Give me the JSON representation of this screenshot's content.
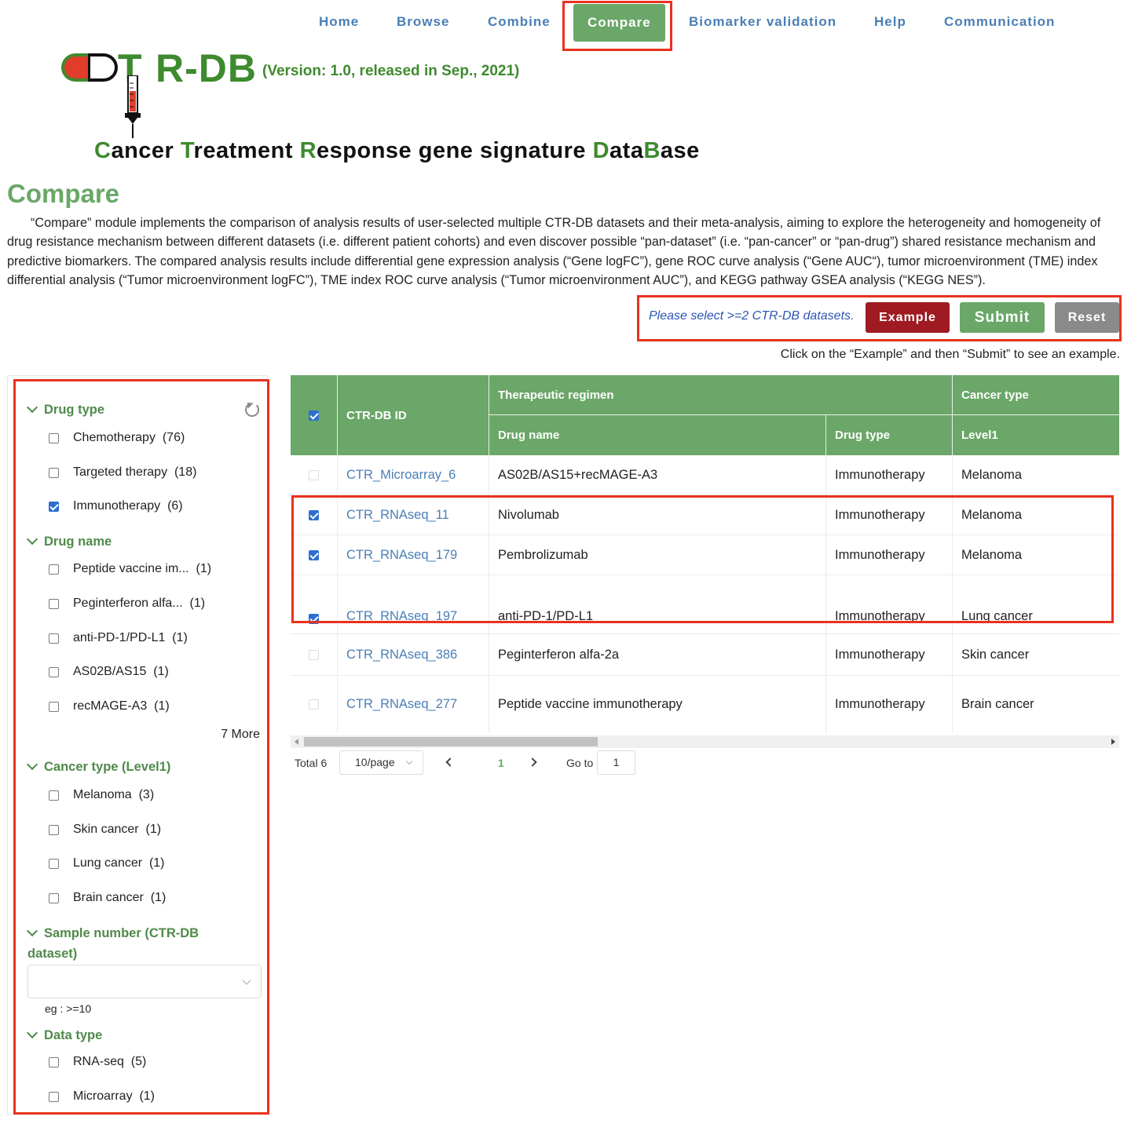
{
  "nav": {
    "items": [
      {
        "label": "Home"
      },
      {
        "label": "Browse"
      },
      {
        "label": "Combine"
      },
      {
        "label": "Compare",
        "active": true
      },
      {
        "label": "Biomarker validation"
      },
      {
        "label": "Help"
      },
      {
        "label": "Communication"
      }
    ]
  },
  "logo": {
    "letter_t": "T",
    "name_rest": "R-DB",
    "version": "(Version: 1.0, released in Sep., 2021)",
    "tagline_parts": [
      {
        "text": "C",
        "green": true
      },
      {
        "text": "ancer ",
        "green": false
      },
      {
        "text": "T",
        "green": true
      },
      {
        "text": "reatment ",
        "green": false
      },
      {
        "text": "R",
        "green": true
      },
      {
        "text": "esponse gene signature ",
        "green": false
      },
      {
        "text": "D",
        "green": true
      },
      {
        "text": "ata",
        "green": false
      },
      {
        "text": "B",
        "green": true
      },
      {
        "text": "ase",
        "green": false
      }
    ]
  },
  "page": {
    "title": "Compare",
    "description": "“Compare” module implements the comparison of analysis results of user-selected multiple CTR-DB datasets and their meta-analysis, aiming to explore the heterogeneity and homogeneity of drug resistance mechanism between different datasets (i.e. different patient cohorts) and even discover possible “pan-dataset” (i.e. “pan-cancer” or “pan-drug”) shared resistance mechanism and predictive biomarkers. The compared analysis results include differential gene expression analysis (“Gene logFC”), gene ROC curve analysis (“Gene AUC“), tumor microenvironment (TME) index differential analysis (“Tumor microenvironment logFC”), TME index ROC curve analysis (“Tumor microenvironment AUC”), and KEGG pathway GSEA analysis (“KEGG NES”)."
  },
  "actions": {
    "hint": "Please select >=2 CTR-DB datasets.",
    "example_label": "Example",
    "submit_label": "Submit",
    "reset_label": "Reset",
    "note": "Click on the “Example” and then “Submit” to see an example."
  },
  "filters": {
    "drug_type": {
      "title": "Drug type",
      "items": [
        {
          "label": "Chemotherapy",
          "count": "(76)",
          "checked": false
        },
        {
          "label": "Targeted therapy",
          "count": "(18)",
          "checked": false
        },
        {
          "label": "Immunotherapy",
          "count": "(6)",
          "checked": true
        }
      ]
    },
    "drug_name": {
      "title": "Drug name",
      "items": [
        {
          "label": "Peptide vaccine im...",
          "count": "(1)",
          "checked": false
        },
        {
          "label": "Peginterferon alfa...",
          "count": "(1)",
          "checked": false
        },
        {
          "label": "anti-PD-1/PD-L1",
          "count": "(1)",
          "checked": false
        },
        {
          "label": "AS02B/AS15",
          "count": "(1)",
          "checked": false
        },
        {
          "label": "recMAGE-A3",
          "count": "(1)",
          "checked": false
        }
      ],
      "more": "7 More"
    },
    "cancer_type": {
      "title": "Cancer type (Level1)",
      "items": [
        {
          "label": "Melanoma",
          "count": "(3)",
          "checked": false
        },
        {
          "label": "Skin cancer",
          "count": "(1)",
          "checked": false
        },
        {
          "label": "Lung cancer",
          "count": "(1)",
          "checked": false
        },
        {
          "label": "Brain cancer",
          "count": "(1)",
          "checked": false
        }
      ]
    },
    "sample_number": {
      "title_line1": "Sample number (CTR-DB",
      "title_line2": "dataset)",
      "value": "",
      "hint": "eg : >=10"
    },
    "data_type": {
      "title": "Data type",
      "items": [
        {
          "label": "RNA-seq",
          "count": "(5)",
          "checked": false
        },
        {
          "label": "Microarray",
          "count": "(1)",
          "checked": false
        }
      ]
    }
  },
  "table": {
    "headers": {
      "id": "CTR-DB ID",
      "regimen": "Therapeutic regimen",
      "cancer_type": "Cancer type",
      "drug_name": "Drug name",
      "drug_type": "Drug type",
      "level1": "Level1"
    },
    "rows": [
      {
        "checked": false,
        "id": "CTR_Microarray_6",
        "drug_name": "AS02B/AS15+recMAGE-A3",
        "drug_type": "Immunotherapy",
        "level1": "Melanoma"
      },
      {
        "checked": true,
        "id": "CTR_RNAseq_11",
        "drug_name": "Nivolumab",
        "drug_type": "Immunotherapy",
        "level1": "Melanoma"
      },
      {
        "checked": true,
        "id": "CTR_RNAseq_179",
        "drug_name": "Pembrolizumab",
        "drug_type": "Immunotherapy",
        "level1": "Melanoma"
      },
      {
        "checked": true,
        "id": "CTR_RNAseq_197",
        "drug_name": "anti-PD-1/PD-L1",
        "drug_type": "Immunotherapy",
        "level1": "Lung cancer"
      },
      {
        "checked": false,
        "id": "CTR_RNAseq_386",
        "drug_name": "Peginterferon alfa-2a",
        "drug_type": "Immunotherapy",
        "level1": "Skin cancer"
      },
      {
        "checked": false,
        "id": "CTR_RNAseq_277",
        "drug_name": "Peptide vaccine immunotherapy",
        "drug_type": "Immunotherapy",
        "level1": "Brain cancer"
      }
    ]
  },
  "pagination": {
    "total": "Total 6",
    "page_size": "10/page",
    "current_page": "1",
    "goto_label": "Go to",
    "goto_value": "1"
  },
  "colors": {
    "brand_green": "#6aa768",
    "logo_green": "#3e8a2e",
    "link_blue": "#4a7fb5",
    "highlight_red": "#e8321e",
    "example_red": "#9e1b22",
    "reset_gray": "#8a8a8a"
  }
}
